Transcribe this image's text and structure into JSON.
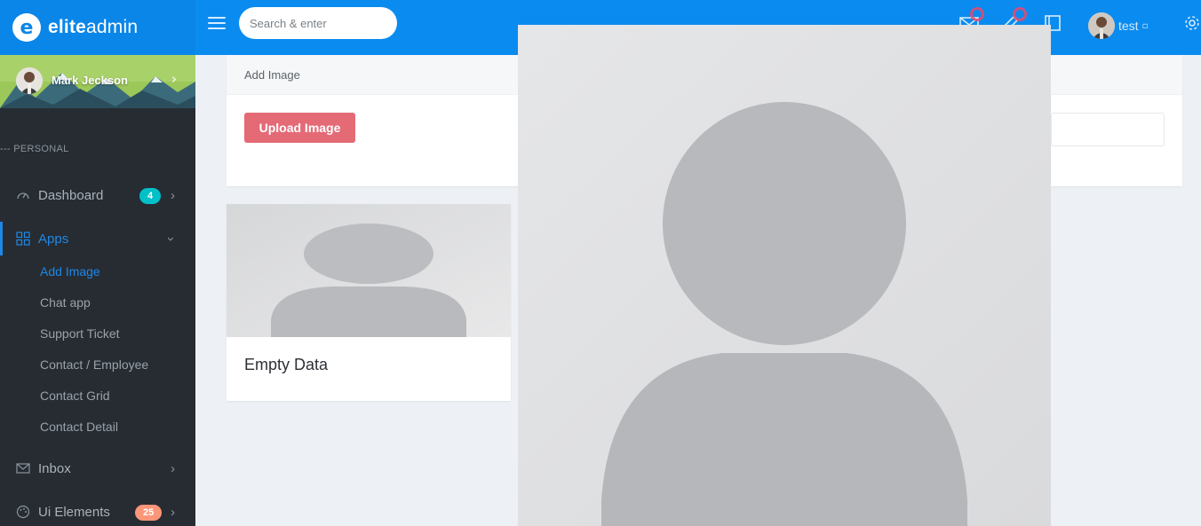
{
  "brand": {
    "logo_letter": "e",
    "name_bold": "elite",
    "name_light": "admin"
  },
  "header": {
    "search_placeholder": "Search & enter",
    "user_name": "test",
    "user_caret": "▫"
  },
  "sidebar": {
    "profile_name": "Mark Jeckson",
    "section_label": "--- PERSONAL",
    "items": [
      {
        "label": "Dashboard",
        "badge": "4",
        "badge_color": "#01c0c8"
      },
      {
        "label": "Apps"
      },
      {
        "label": "Inbox"
      },
      {
        "label": "Ui Elements",
        "badge": "25",
        "badge_color": "#fb9678"
      }
    ],
    "apps_sub": [
      {
        "label": "Add Image"
      },
      {
        "label": "Chat app"
      },
      {
        "label": "Support Ticket"
      },
      {
        "label": "Contact / Employee"
      },
      {
        "label": "Contact Grid"
      },
      {
        "label": "Contact Detail"
      }
    ]
  },
  "content": {
    "card_title": "Add Image",
    "upload_label": "Upload Image",
    "empty_title": "Empty Data"
  },
  "colors": {
    "primary": "#0a8bf0",
    "sidebar": "#272c33",
    "danger": "#e46a76",
    "active": "#1e88e5"
  }
}
